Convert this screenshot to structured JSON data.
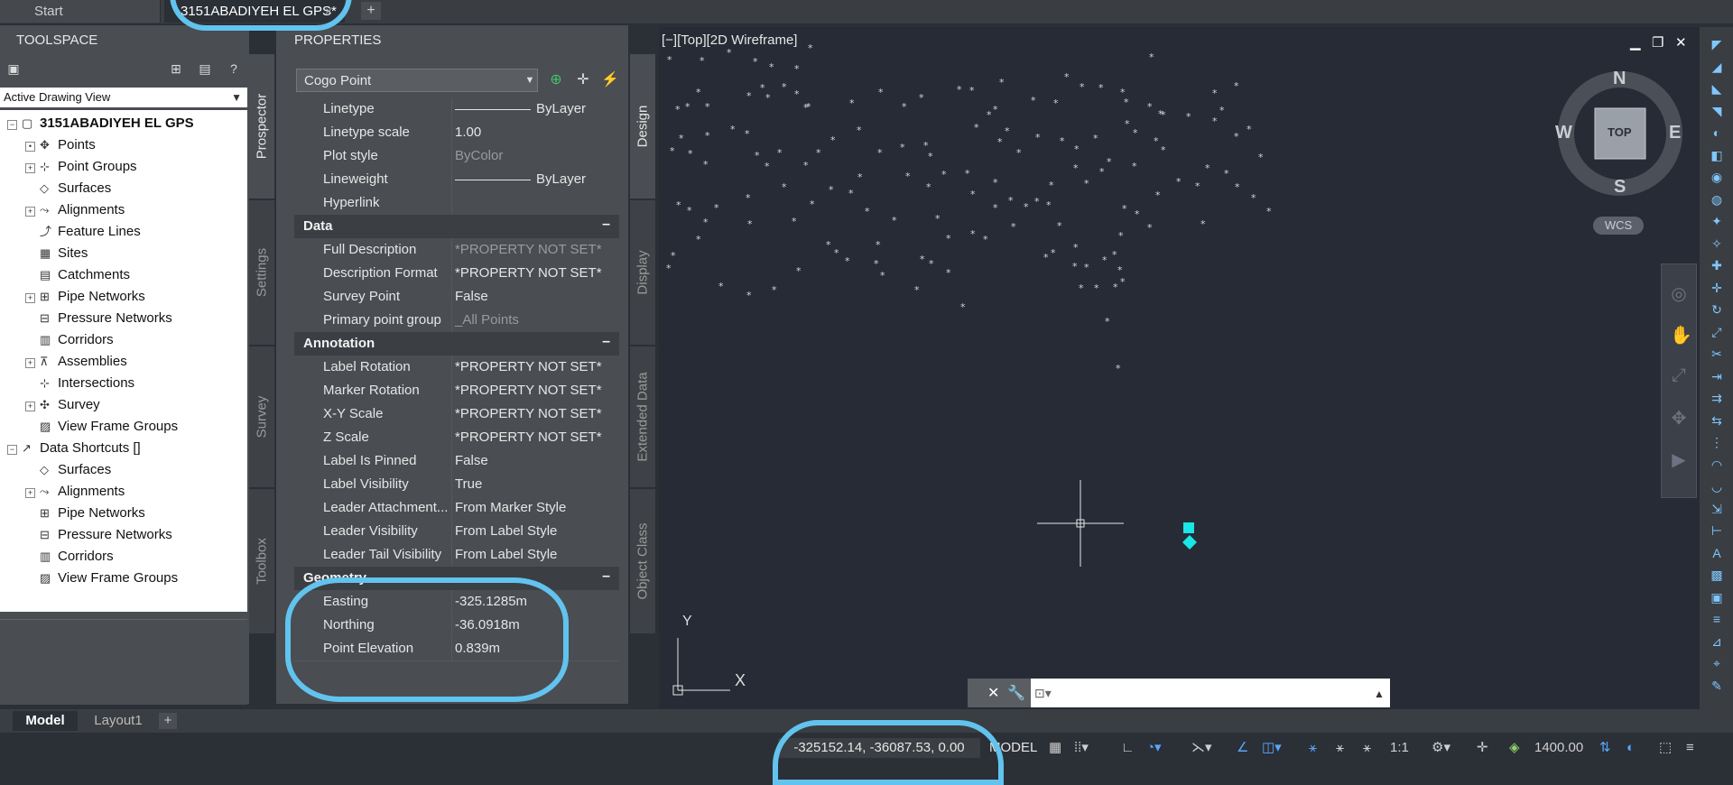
{
  "tabs": {
    "start": "Start",
    "active": "3151ABADIYEH EL GPS*",
    "close": "×",
    "add": "+"
  },
  "toolspace": {
    "title": "TOOLSPACE",
    "view_select": "Active Drawing View",
    "tree": [
      {
        "label": "3151ABADIYEH EL GPS",
        "level": 0,
        "expand": "minus",
        "bold": true,
        "icon": "drawing-icon"
      },
      {
        "label": "Points",
        "level": 1,
        "expand": "dot",
        "icon": "points-icon"
      },
      {
        "label": "Point Groups",
        "level": 1,
        "expand": "plus",
        "icon": "point-groups-icon"
      },
      {
        "label": "Surfaces",
        "level": 1,
        "expand": "",
        "icon": "surfaces-icon"
      },
      {
        "label": "Alignments",
        "level": 1,
        "expand": "plus",
        "icon": "alignments-icon"
      },
      {
        "label": "Feature Lines",
        "level": 1,
        "expand": "",
        "icon": "feature-lines-icon"
      },
      {
        "label": "Sites",
        "level": 1,
        "expand": "",
        "icon": "sites-icon"
      },
      {
        "label": "Catchments",
        "level": 1,
        "expand": "",
        "icon": "catchments-icon"
      },
      {
        "label": "Pipe Networks",
        "level": 1,
        "expand": "plus",
        "icon": "pipe-networks-icon"
      },
      {
        "label": "Pressure Networks",
        "level": 1,
        "expand": "",
        "icon": "pressure-networks-icon"
      },
      {
        "label": "Corridors",
        "level": 1,
        "expand": "",
        "icon": "corridors-icon"
      },
      {
        "label": "Assemblies",
        "level": 1,
        "expand": "plus",
        "icon": "assemblies-icon"
      },
      {
        "label": "Intersections",
        "level": 1,
        "expand": "",
        "icon": "intersections-icon"
      },
      {
        "label": "Survey",
        "level": 1,
        "expand": "plus",
        "icon": "survey-icon"
      },
      {
        "label": "View Frame Groups",
        "level": 1,
        "expand": "",
        "icon": "view-frame-groups-icon"
      },
      {
        "label": "Data Shortcuts []",
        "level": 0,
        "expand": "minus",
        "icon": "data-shortcuts-icon"
      },
      {
        "label": "Surfaces",
        "level": 1,
        "expand": "",
        "icon": "surfaces-icon"
      },
      {
        "label": "Alignments",
        "level": 1,
        "expand": "plus",
        "icon": "alignments-icon"
      },
      {
        "label": "Pipe Networks",
        "level": 1,
        "expand": "",
        "icon": "pipe-networks-icon"
      },
      {
        "label": "Pressure Networks",
        "level": 1,
        "expand": "",
        "icon": "pressure-networks-icon"
      },
      {
        "label": "Corridors",
        "level": 1,
        "expand": "",
        "icon": "corridors-icon"
      },
      {
        "label": "View Frame Groups",
        "level": 1,
        "expand": "",
        "icon": "view-frame-groups-icon"
      }
    ],
    "vtabs": {
      "prospector": "Prospector",
      "settings": "Settings",
      "survey": "Survey",
      "toolbox": "Toolbox"
    }
  },
  "properties": {
    "title": "PROPERTIES",
    "object_type": "Cogo Point",
    "vtabs": {
      "design": "Design",
      "display": "Display",
      "extended": "Extended Data",
      "object_class": "Object Class"
    },
    "rows": [
      {
        "kind": "row",
        "name": "Linetype",
        "value": "ByLayer",
        "line": true
      },
      {
        "kind": "row",
        "name": "Linetype scale",
        "value": "1.00"
      },
      {
        "kind": "row",
        "name": "Plot style",
        "value": "ByColor",
        "dim": true
      },
      {
        "kind": "row",
        "name": "Lineweight",
        "value": "ByLayer",
        "line": true
      },
      {
        "kind": "row",
        "name": "Hyperlink",
        "value": ""
      },
      {
        "kind": "cat",
        "name": "Data"
      },
      {
        "kind": "row",
        "name": "Full Description",
        "value": "*PROPERTY NOT SET*",
        "dim": true
      },
      {
        "kind": "row",
        "name": "Description Format",
        "value": "*PROPERTY NOT SET*"
      },
      {
        "kind": "row",
        "name": "Survey Point",
        "value": "False"
      },
      {
        "kind": "row",
        "name": "Primary point group",
        "value": "_All Points",
        "dim": true
      },
      {
        "kind": "cat",
        "name": "Annotation"
      },
      {
        "kind": "row",
        "name": "Label Rotation",
        "value": "*PROPERTY NOT SET*"
      },
      {
        "kind": "row",
        "name": "Marker Rotation",
        "value": "*PROPERTY NOT SET*"
      },
      {
        "kind": "row",
        "name": "X-Y Scale",
        "value": "*PROPERTY NOT SET*"
      },
      {
        "kind": "row",
        "name": "Z Scale",
        "value": "*PROPERTY NOT SET*"
      },
      {
        "kind": "row",
        "name": "Label Is Pinned",
        "value": "False"
      },
      {
        "kind": "row",
        "name": "Label Visibility",
        "value": "True"
      },
      {
        "kind": "row",
        "name": "Leader Attachment...",
        "value": "From Marker Style"
      },
      {
        "kind": "row",
        "name": "Leader Visibility",
        "value": "From Label Style"
      },
      {
        "kind": "row",
        "name": "Leader Tail Visibility",
        "value": "From Label Style"
      },
      {
        "kind": "cat",
        "name": "Geometry"
      },
      {
        "kind": "row",
        "name": "Easting",
        "value": "-325.1285m"
      },
      {
        "kind": "row",
        "name": "Northing",
        "value": "-36.0918m"
      },
      {
        "kind": "row",
        "name": "Point Elevation",
        "value": "0.839m"
      }
    ],
    "collapse_symbol": "–"
  },
  "viewport": {
    "label": "[−][Top][2D Wireframe]",
    "compass": {
      "n": "N",
      "s": "S",
      "e": "E",
      "w": "W",
      "top": "TOP"
    },
    "wcs": "WCS",
    "ucs_x": "X",
    "ucs_y": "Y",
    "point_color": "#d0d4da",
    "selection_color": "#19e6e6"
  },
  "layouts": {
    "model": "Model",
    "layout1": "Layout1",
    "add": "+"
  },
  "status": {
    "coords": "-325152.14, -36087.53, 0.00",
    "model": "MODEL",
    "annotation_scale": "1:1",
    "elevation": "1400.00"
  },
  "colors": {
    "highlight": "#61c3ee",
    "accent": "#7fc7ff"
  }
}
